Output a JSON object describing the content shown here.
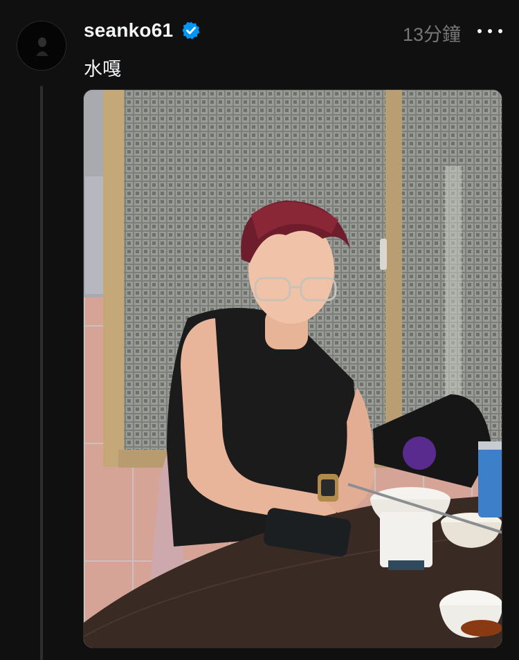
{
  "post": {
    "username": "seanko61",
    "verified": true,
    "timestamp": "13分鐘",
    "caption": "水嘎",
    "more_icon": "more-horizontal-icon",
    "verified_icon": "verified-badge-icon",
    "accent_color": "#0095f6",
    "background_color": "#101010",
    "secondary_text_color": "#777777"
  }
}
